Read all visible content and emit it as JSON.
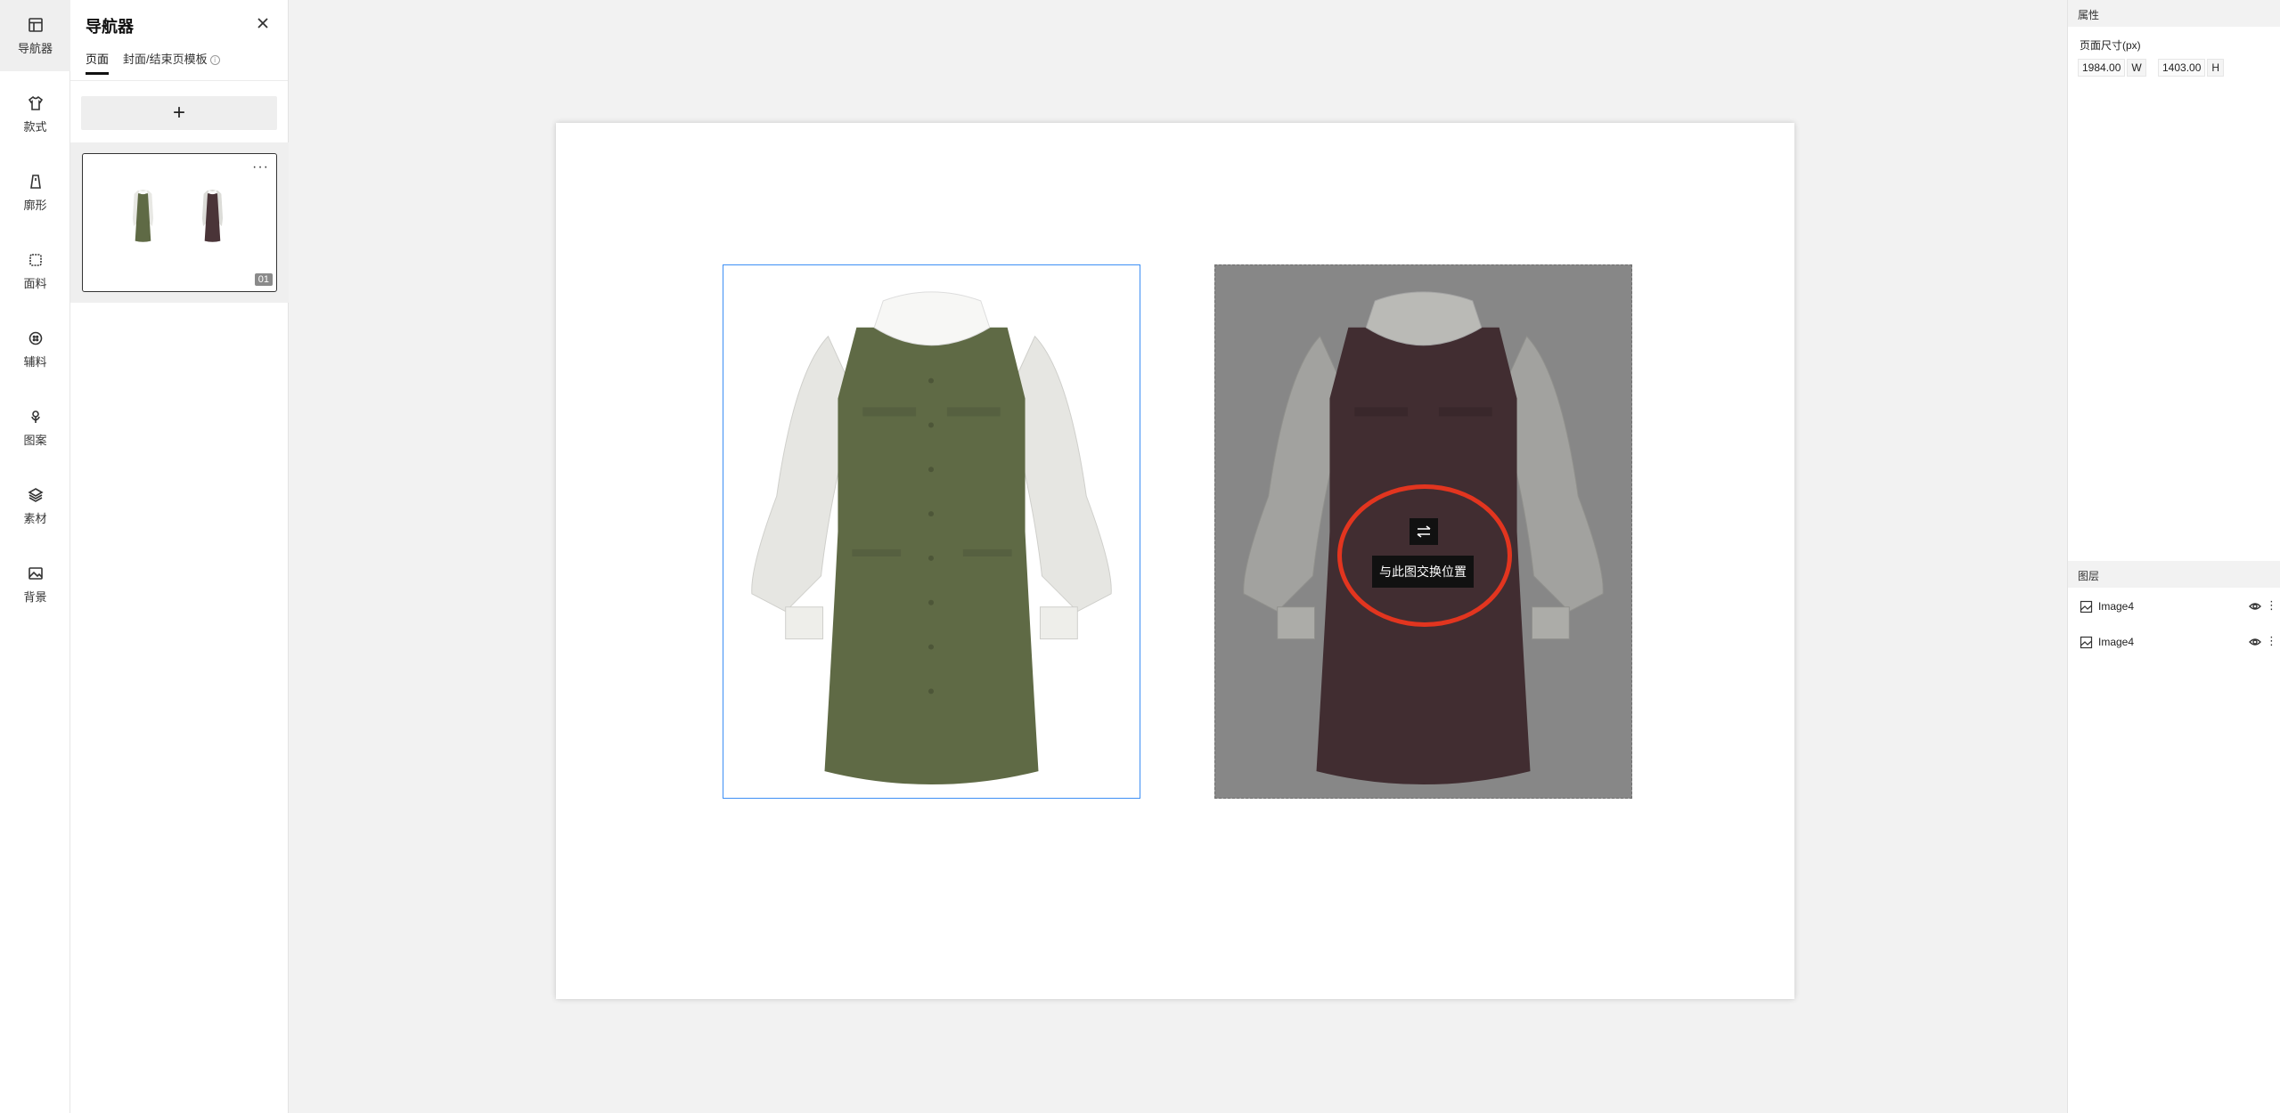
{
  "sidebar": {
    "items": [
      {
        "label": "导航器",
        "icon": "layout-icon"
      },
      {
        "label": "款式",
        "icon": "shirt-icon"
      },
      {
        "label": "廓形",
        "icon": "silhouette-icon"
      },
      {
        "label": "面料",
        "icon": "fabric-icon"
      },
      {
        "label": "辅料",
        "icon": "button-icon"
      },
      {
        "label": "图案",
        "icon": "flower-icon"
      },
      {
        "label": "素材",
        "icon": "layers-icon"
      },
      {
        "label": "背景",
        "icon": "image-icon"
      }
    ]
  },
  "navigator": {
    "title": "导航器",
    "tabs": [
      {
        "label": "页面"
      },
      {
        "label": "封面/结束页模板"
      }
    ],
    "add_label": "+",
    "page_number": "01",
    "more_label": "···"
  },
  "canvas": {
    "swap_tooltip": "与此图交换位置",
    "left_dress_color": "#5f6a45",
    "right_dress_color": "#4a3438",
    "highlight_color": "#e2351f",
    "selection_color": "#3d8ff5"
  },
  "properties": {
    "header": "属性",
    "page_size_label": "页面尺寸(px)",
    "width_value": "1984.00",
    "width_unit": "W",
    "height_value": "1403.00",
    "height_unit": "H"
  },
  "layers": {
    "header": "图层",
    "items": [
      {
        "name": "Image4"
      },
      {
        "name": "Image4"
      }
    ]
  }
}
